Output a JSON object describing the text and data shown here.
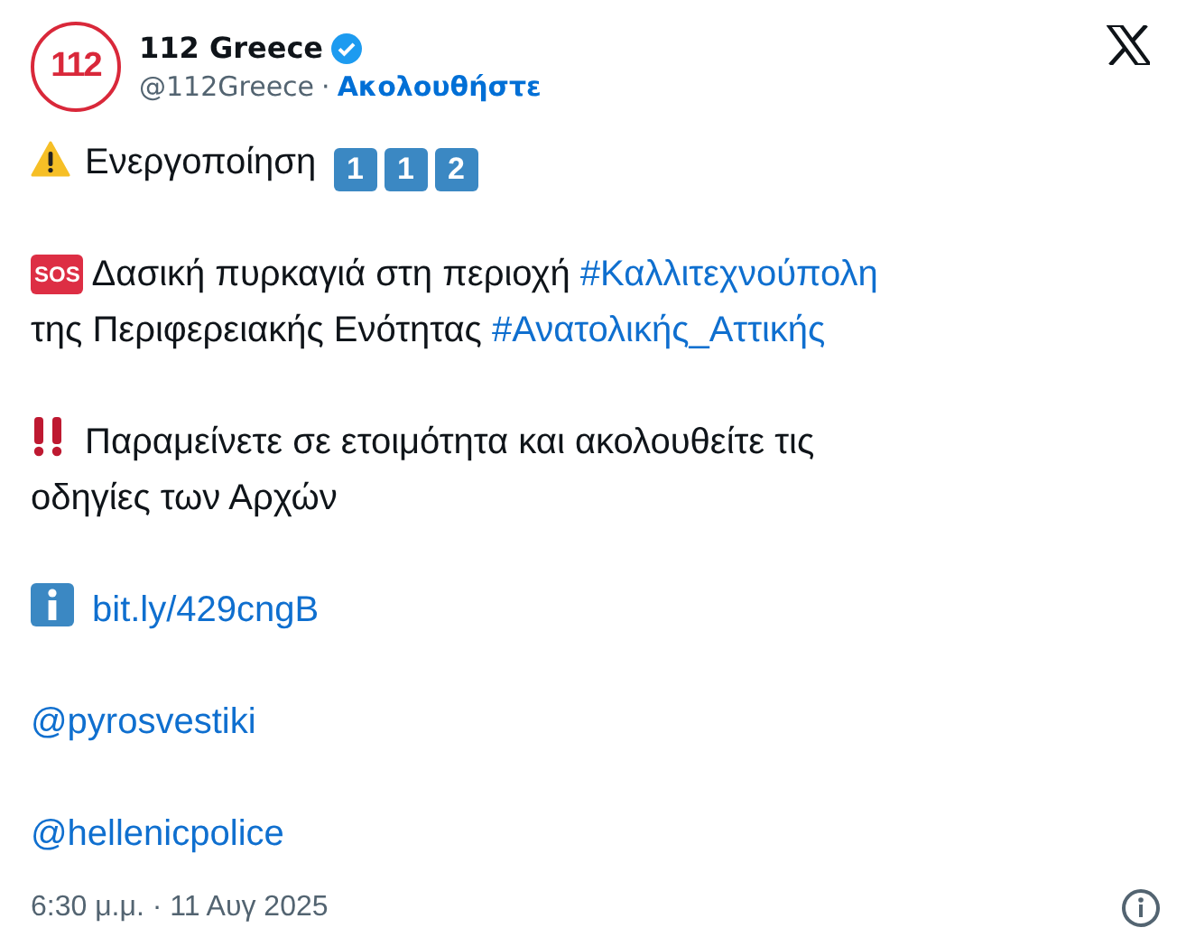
{
  "author": {
    "logo_text": "112",
    "name": "112 Greece",
    "verified": true,
    "handle": "@112Greece",
    "separator": "·",
    "follow": "Ακολουθήστε"
  },
  "paragraphs": [
    {
      "kind": "warning",
      "segments": [
        {
          "kind": "text",
          "text": "Ενεργοποίηση "
        },
        {
          "kind": "keycap",
          "text": "1"
        },
        {
          "kind": "keycap",
          "text": "1"
        },
        {
          "kind": "keycap",
          "text": "2"
        }
      ]
    },
    {
      "kind": "plain",
      "segments": [
        {
          "kind": "badge",
          "text": "SOS"
        },
        {
          "kind": "text",
          "text": " Δασική πυρκαγιά στη περιοχή "
        },
        {
          "kind": "link",
          "text": "#Καλλιτεχνούπολη"
        },
        {
          "kind": "text",
          "text": " της Περιφερειακής Ενότητας "
        },
        {
          "kind": "link",
          "text": "#Ανατολικής_Αττικής"
        }
      ]
    },
    {
      "kind": "alert",
      "segments": [
        {
          "kind": "text",
          "text": "Παραμείνετε σε ετοιμότητα και ακολουθείτε τις οδηγίες των Αρχών"
        }
      ]
    },
    {
      "kind": "info",
      "segments": [
        {
          "kind": "link",
          "text": "bit.ly/429cngB"
        }
      ]
    },
    {
      "kind": "plain",
      "segments": [
        {
          "kind": "link",
          "text": "@pyrosvestiki"
        }
      ]
    },
    {
      "kind": "plain",
      "segments": [
        {
          "kind": "link",
          "text": "@hellenicpolice"
        }
      ]
    }
  ],
  "timestamp": "6:30 μ.μ. · 11 Αυγ 2025"
}
